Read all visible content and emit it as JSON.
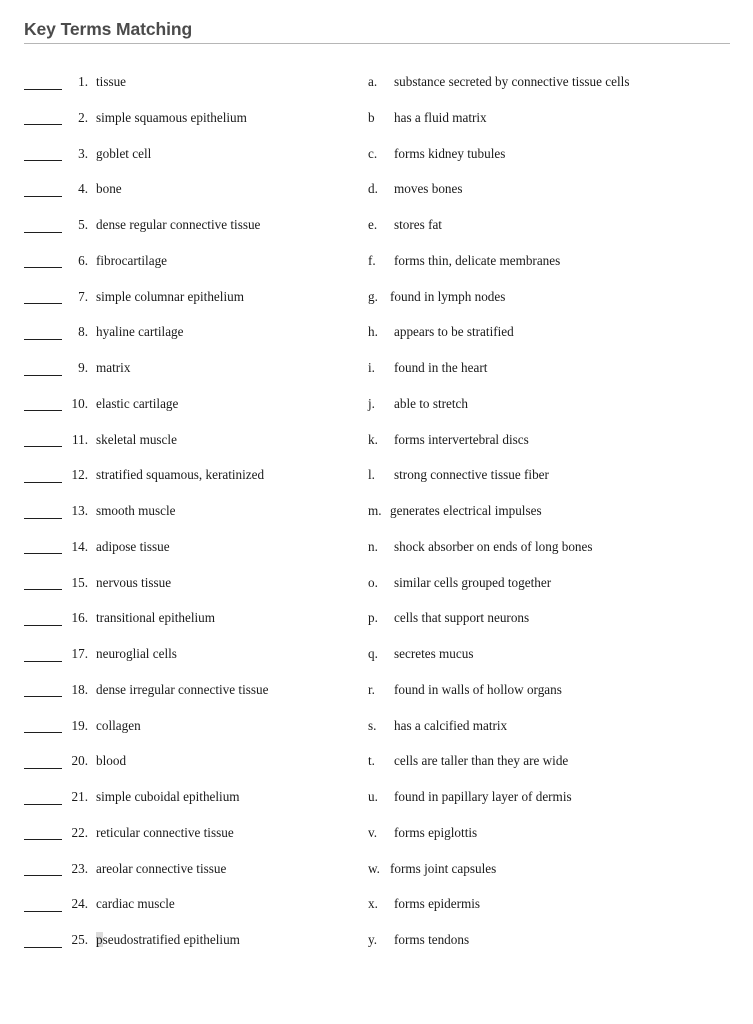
{
  "document": {
    "title": "Key Terms Matching",
    "title_color": "#4b4b4b",
    "rule_color": "#b6b6b6",
    "background": "#ffffff",
    "text_color": "#1a1a1a",
    "highlight_color": "#dcdcdc"
  },
  "terms": [
    {
      "num": "1.",
      "label": "tissue"
    },
    {
      "num": "2.",
      "label": "simple squamous epithelium"
    },
    {
      "num": "3.",
      "label": "goblet cell"
    },
    {
      "num": "4.",
      "label": "bone"
    },
    {
      "num": "5.",
      "label": "dense regular connective tissue"
    },
    {
      "num": "6.",
      "label": "fibrocartilage"
    },
    {
      "num": "7.",
      "label": "simple columnar epithelium"
    },
    {
      "num": "8.",
      "label": "hyaline cartilage"
    },
    {
      "num": "9.",
      "label": "matrix"
    },
    {
      "num": "10.",
      "label": "elastic cartilage"
    },
    {
      "num": "11.",
      "label": "skeletal muscle"
    },
    {
      "num": "12.",
      "label": "stratified squamous, keratinized"
    },
    {
      "num": "13.",
      "label": "smooth muscle"
    },
    {
      "num": "14.",
      "label": "adipose tissue"
    },
    {
      "num": "15.",
      "label": "nervous tissue"
    },
    {
      "num": "16.",
      "label": "transitional epithelium"
    },
    {
      "num": "17.",
      "label": "neuroglial cells"
    },
    {
      "num": "18.",
      "label": "dense irregular connective tissue"
    },
    {
      "num": "19.",
      "label": "collagen"
    },
    {
      "num": "20.",
      "label": "blood"
    },
    {
      "num": "21.",
      "label": "simple cuboidal epithelium"
    },
    {
      "num": "22.",
      "label": "reticular connective tissue"
    },
    {
      "num": "23.",
      "label": "areolar connective tissue"
    },
    {
      "num": "24.",
      "label": "cardiac muscle"
    },
    {
      "num": "25.",
      "label": "pseudostratified epithelium",
      "highlight_prefix": "p",
      "highlight_rest": "seudostratified epithelium"
    }
  ],
  "definitions": [
    {
      "letter": "a.",
      "label": "substance secreted by connective tissue cells"
    },
    {
      "letter": "b",
      "label": "has a fluid matrix"
    },
    {
      "letter": "c.",
      "label": "forms kidney tubules"
    },
    {
      "letter": "d.",
      "label": "moves bones"
    },
    {
      "letter": "e.",
      "label": "stores fat"
    },
    {
      "letter": "f.",
      "label": "forms thin, delicate membranes"
    },
    {
      "letter": "g.",
      "label": "found in lymph nodes",
      "wide": true
    },
    {
      "letter": "h.",
      "label": "appears to be stratified"
    },
    {
      "letter": "i.",
      "label": "found in the heart"
    },
    {
      "letter": "j.",
      "label": "able to stretch"
    },
    {
      "letter": "k.",
      "label": "forms intervertebral discs"
    },
    {
      "letter": "l.",
      "label": "strong connective tissue fiber"
    },
    {
      "letter": "m.",
      "label": "generates electrical impulses",
      "wide": true
    },
    {
      "letter": "n.",
      "label": "shock absorber on ends of long bones"
    },
    {
      "letter": "o.",
      "label": "similar cells grouped together"
    },
    {
      "letter": "p.",
      "label": "cells that support neurons"
    },
    {
      "letter": "q.",
      "label": "secretes mucus"
    },
    {
      "letter": "r.",
      "label": "found in walls of hollow organs"
    },
    {
      "letter": "s.",
      "label": "has a calcified matrix"
    },
    {
      "letter": "t.",
      "label": "cells are taller than they are wide"
    },
    {
      "letter": "u.",
      "label": "found in papillary layer of dermis"
    },
    {
      "letter": "v.",
      "label": "forms epiglottis"
    },
    {
      "letter": "w.",
      "label": "forms joint capsules",
      "wide": true
    },
    {
      "letter": "x.",
      "label": "forms epidermis"
    },
    {
      "letter": "y.",
      "label": "forms tendons"
    }
  ]
}
